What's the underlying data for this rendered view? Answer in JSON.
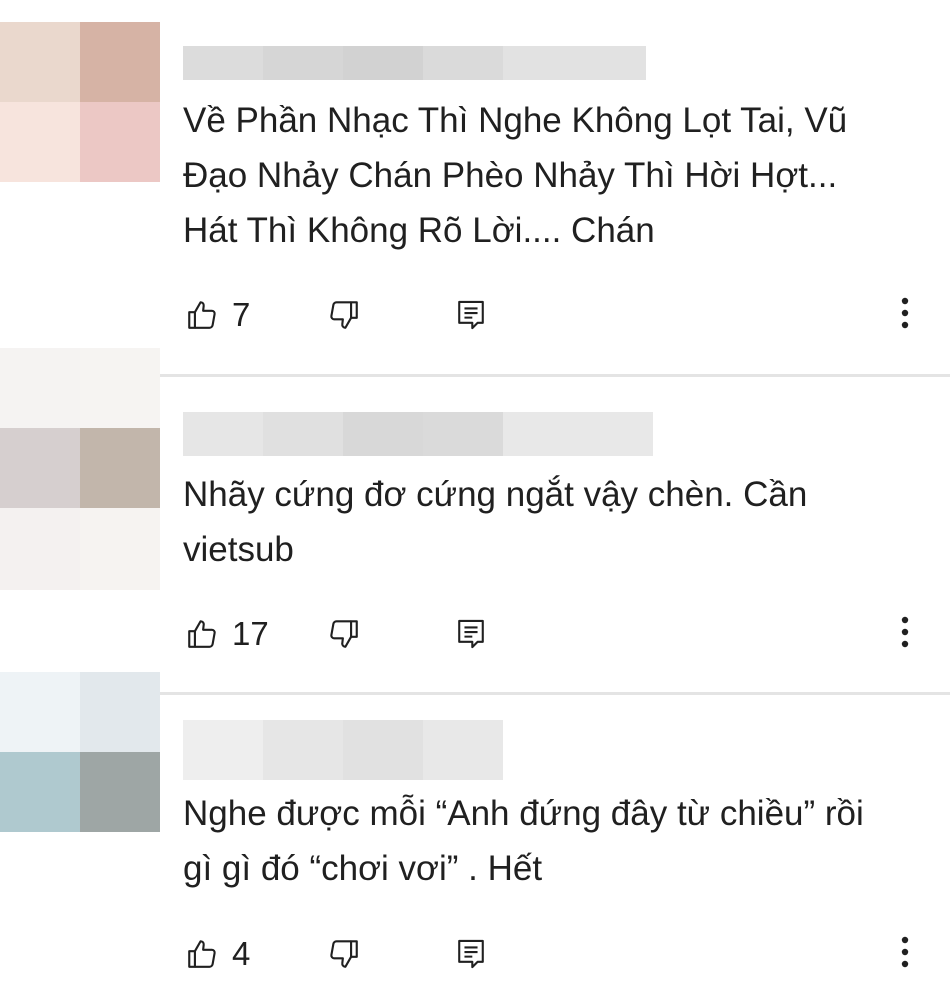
{
  "comments": [
    {
      "text": "Về Phần Nhạc Thì Nghe Không Lọt Tai, Vũ\nĐạo Nhảy Chán Phèo Nhảy Thì Hời Hợt...\nHát Thì Không Rõ Lời.... Chán",
      "likes": "7",
      "avatar_colors": [
        "#ead8cd",
        "#d6b3a5",
        "#f7e4dd",
        "#ecc8c5"
      ],
      "username_blur_colors": [
        "#dcdcdc",
        "#d6d6d6",
        "#d2d2d2",
        "#dadada",
        "#e2e2e2"
      ]
    },
    {
      "text": "Nhãy cứng đơ cứng ngắt vậy chèn. Cần\nvietsub",
      "likes": "17",
      "avatar_colors": [
        "#f5f3f2",
        "#f6f4f2",
        "#d6cfcf",
        "#c2b6ab"
      ],
      "avatar_lower_colors": [
        "#f4f1f0",
        "#f6f3f1"
      ],
      "username_blur_colors": [
        "#e6e6e6",
        "#e0e0e0",
        "#d8d8d8",
        "#dadada",
        "#e8e8e8"
      ]
    },
    {
      "text": "Nghe được mỗi “Anh đứng đây từ chiều” rồi\ngì gì đó “chơi vơi” . Hết",
      "likes": "4",
      "avatar_colors": [
        "#eef3f6",
        "#e2e8ec",
        "#afc9cf",
        "#9ea6a5"
      ],
      "username_blur_colors": [
        "#eeeeee",
        "#e6e6e6",
        "#e1e1e1",
        "#e8e8e8"
      ]
    }
  ],
  "icons": {
    "like": "thumb-up-icon",
    "dislike": "thumb-down-icon",
    "reply": "reply-comment-icon",
    "more": "more-vertical-icon"
  }
}
